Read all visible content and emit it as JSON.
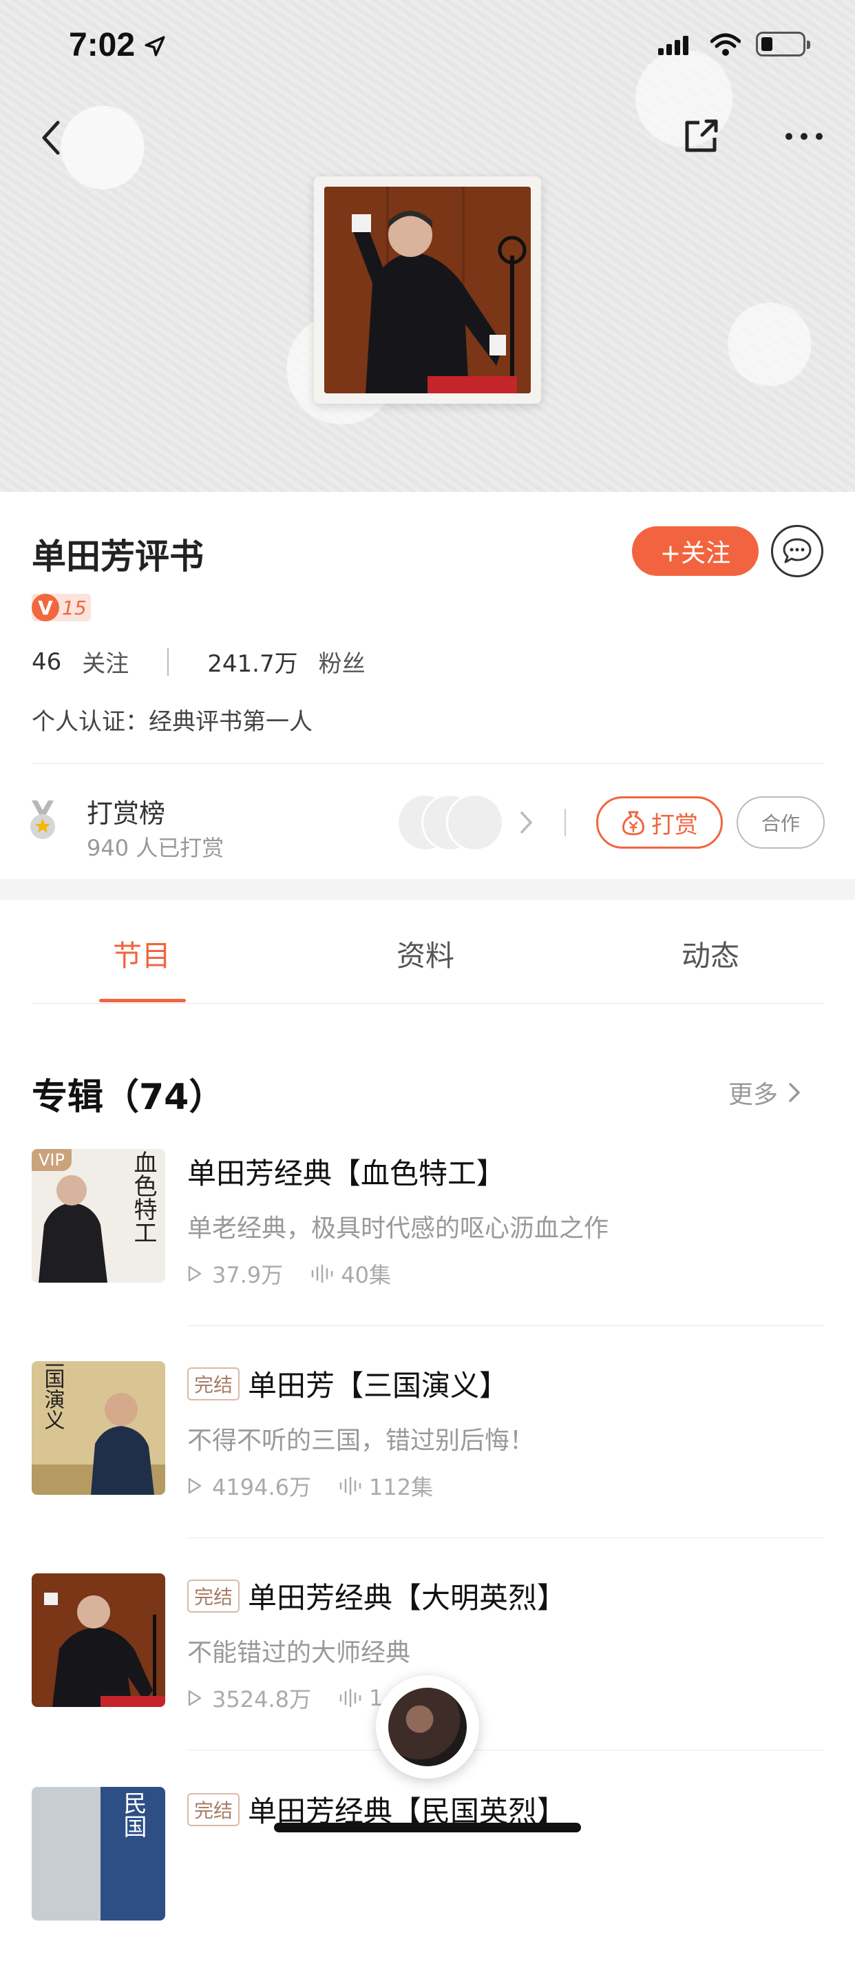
{
  "status_bar": {
    "time": "7:02"
  },
  "profile": {
    "name": "单田芳评书",
    "follow_label": "+关注",
    "vip_letter": "V",
    "vip_level": "15",
    "following_count": "46",
    "following_label": "关注",
    "fans_count": "241.7万",
    "fans_label": "粉丝",
    "certification": "个人认证：经典评书第一人"
  },
  "reward": {
    "title": "打赏榜",
    "count_text": "940 人已打赏",
    "tip_label": "打赏",
    "coop_label": "合作"
  },
  "tabs": [
    {
      "label": "节目",
      "active": true
    },
    {
      "label": "资料",
      "active": false
    },
    {
      "label": "动态",
      "active": false
    }
  ],
  "albums_section": {
    "title": "专辑（74）",
    "more_label": "更多"
  },
  "albums": [
    {
      "badge": "",
      "vip": "VIP",
      "title": "单田芳经典【血色特工】",
      "desc": "单老经典，极具时代感的呕心沥血之作",
      "plays": "37.9万",
      "episodes": "40集",
      "cover_text": "血色特工"
    },
    {
      "badge": "完结",
      "vip": "",
      "title": "单田芳【三国演义】",
      "desc": "不得不听的三国，错过别后悔！",
      "plays": "4194.6万",
      "episodes": "112集",
      "cover_text": "三国演义"
    },
    {
      "badge": "完结",
      "vip": "",
      "title": "单田芳经典【大明英烈】",
      "desc": "不能错过的大师经典",
      "plays": "3524.8万",
      "episodes": "1",
      "cover_text": ""
    },
    {
      "badge": "完结",
      "vip": "",
      "title": "单田芳经典【民国英烈】",
      "desc": "",
      "plays": "",
      "episodes": "",
      "cover_text": "民国"
    }
  ],
  "colors": {
    "accent": "#f2643f",
    "muted": "#999999"
  }
}
